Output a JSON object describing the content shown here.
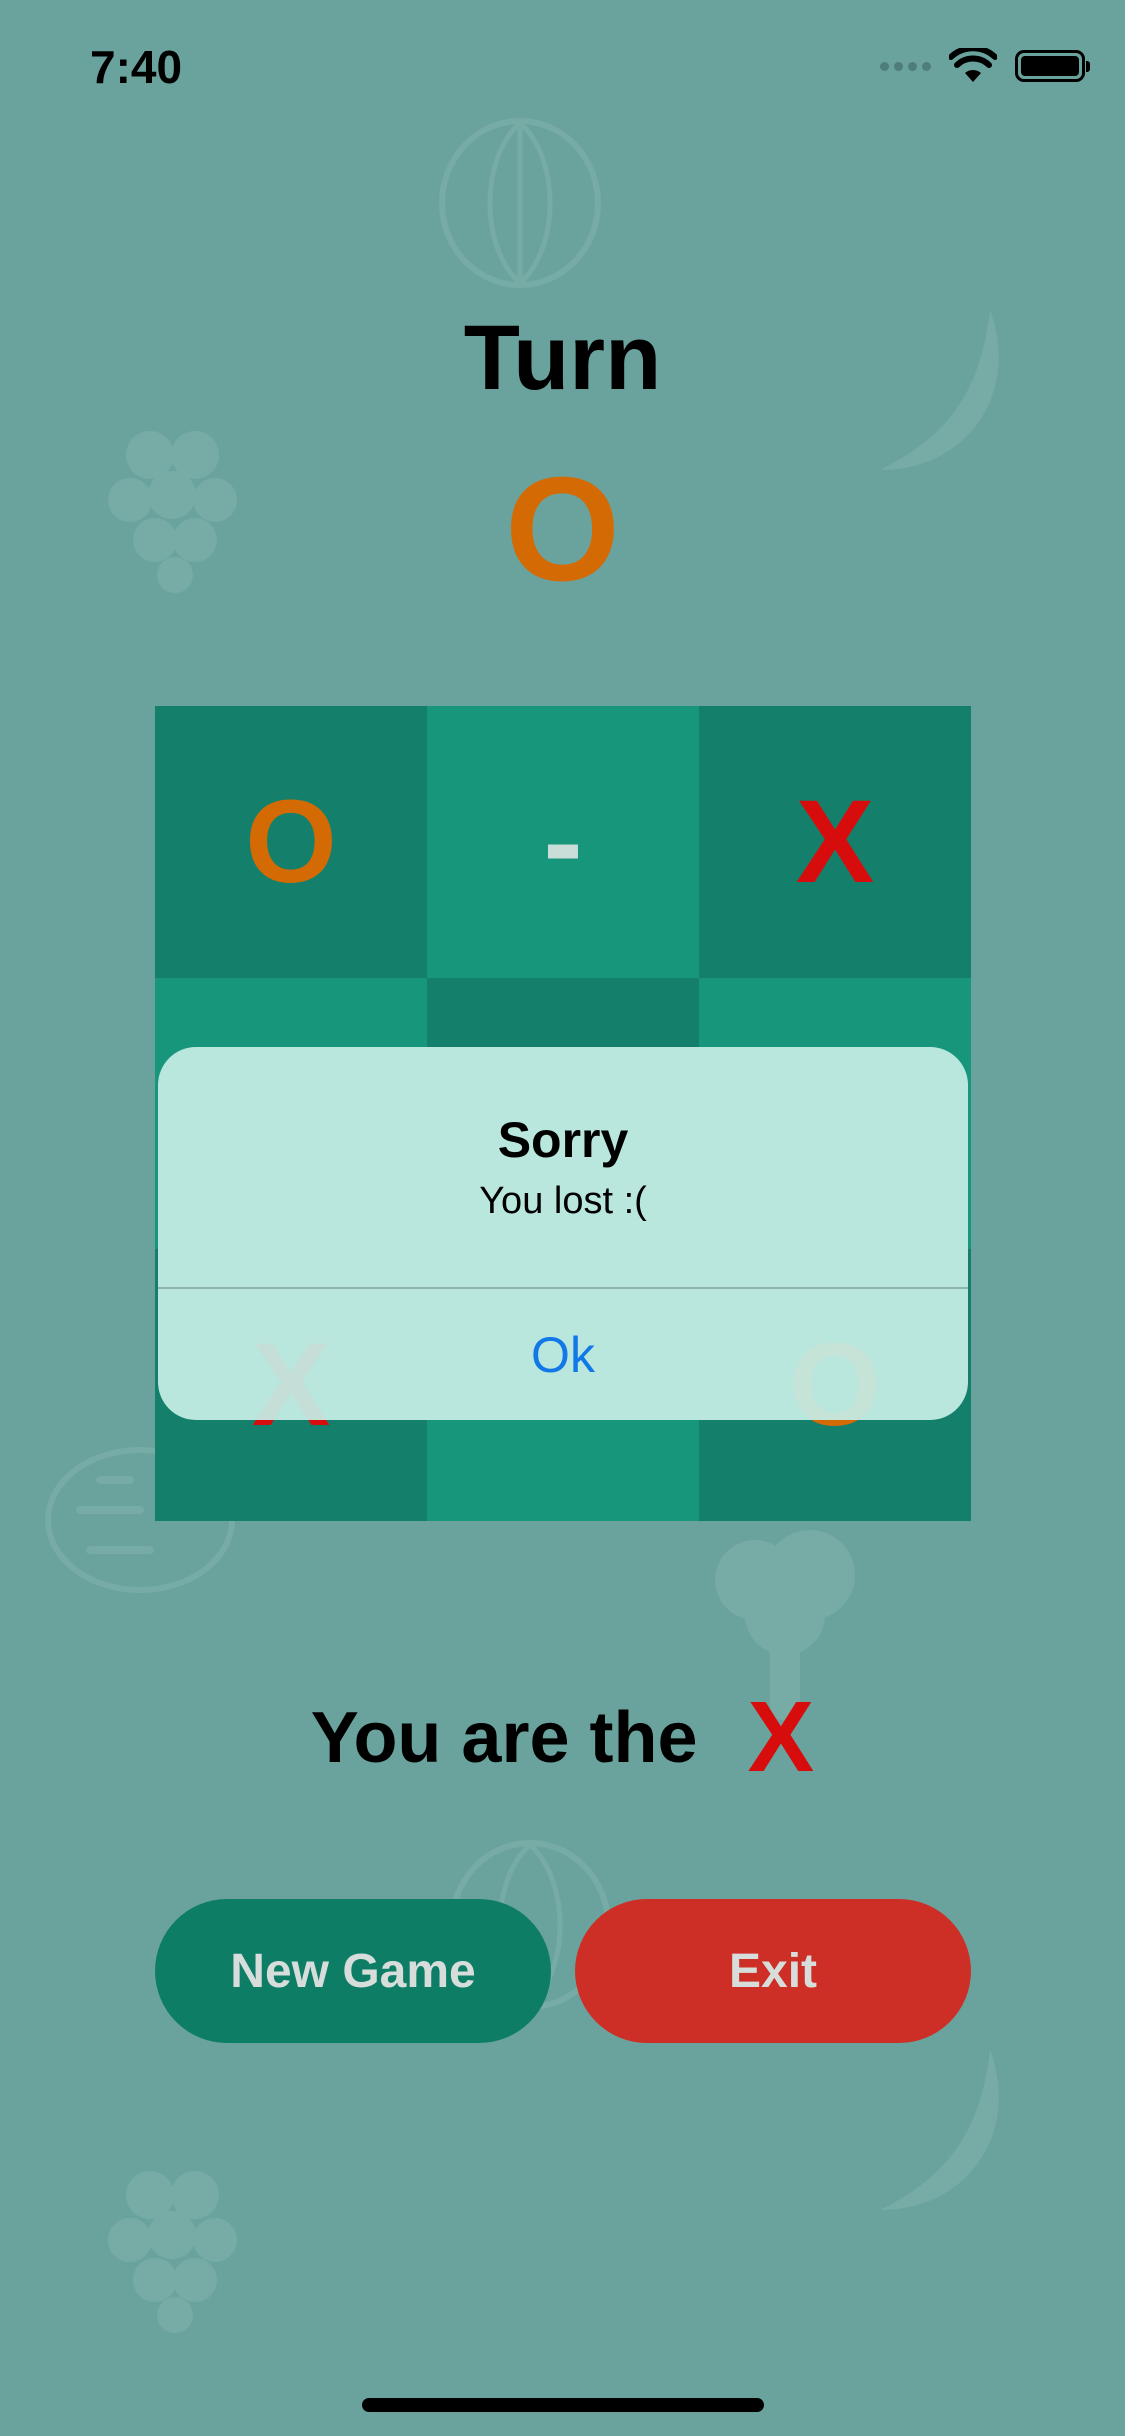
{
  "status_bar": {
    "time": "7:40"
  },
  "game": {
    "turn_title": "Turn",
    "turn_symbol": "O",
    "board": [
      [
        "O",
        "-",
        "X"
      ],
      [
        "",
        "",
        ""
      ],
      [
        "X",
        "",
        "O"
      ]
    ],
    "player_label": "You are the",
    "player_symbol": "X"
  },
  "alert": {
    "title": "Sorry",
    "message": "You lost :(",
    "ok_label": "Ok"
  },
  "buttons": {
    "new_game": "New Game",
    "exit": "Exit"
  },
  "colors": {
    "background": "#6aa39d",
    "o_color": "#d46a04",
    "x_color": "#d70d0d",
    "cell_dark": "#14806b",
    "cell_light": "#17967b",
    "new_game_button": "#0e7d66",
    "exit_button": "#cd2f26",
    "alert_link": "#1178e8"
  },
  "icons": [
    "wifi-icon",
    "battery-icon",
    "signal-icon",
    "watermelon-icon",
    "banana-icon",
    "grapes-icon",
    "lemon-icon",
    "broccoli-icon"
  ]
}
